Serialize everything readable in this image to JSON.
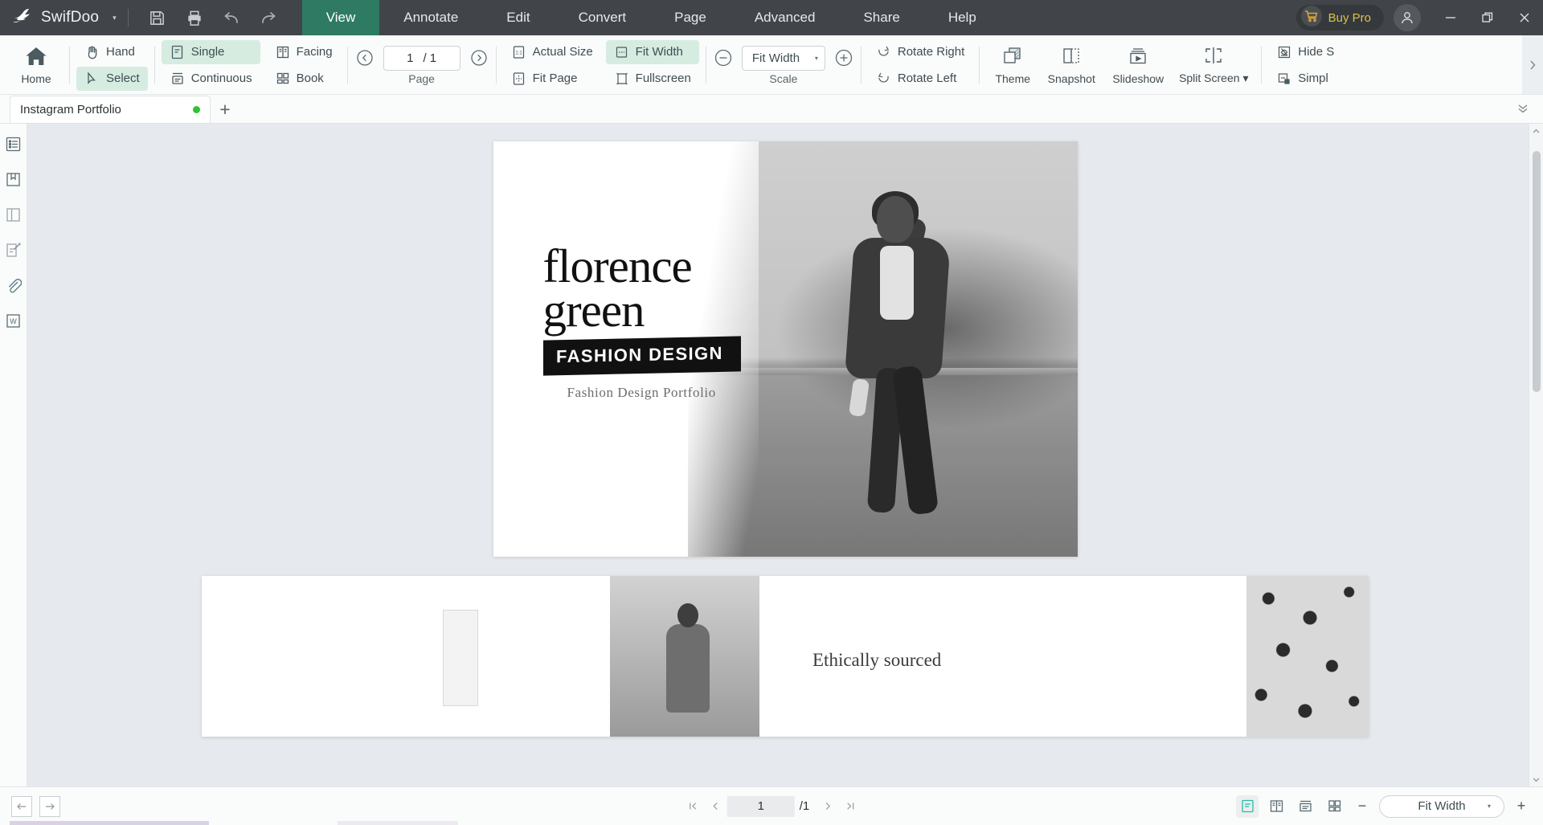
{
  "titlebar": {
    "brand": "SwifDoo",
    "brand_caret": "▾",
    "icons": {
      "save": "save-icon",
      "print": "print-icon",
      "undo": "undo-icon",
      "redo": "redo-icon"
    },
    "menus": [
      {
        "label": "View",
        "active": true
      },
      {
        "label": "Annotate",
        "active": false
      },
      {
        "label": "Edit",
        "active": false
      },
      {
        "label": "Convert",
        "active": false
      },
      {
        "label": "Page",
        "active": false
      },
      {
        "label": "Advanced",
        "active": false
      },
      {
        "label": "Share",
        "active": false
      },
      {
        "label": "Help",
        "active": false
      }
    ],
    "buy_pro": "Buy Pro",
    "account_icon": "user-account-icon",
    "window": {
      "minimize": "—",
      "restore": "❐",
      "close": "✕"
    },
    "colors": {
      "bar_bg": "#414549",
      "active_tab": "#2f7a62",
      "buy_pro_text": "#d9c24b"
    }
  },
  "ribbon": {
    "home": {
      "label": "Home",
      "icon": "home-icon"
    },
    "tools": [
      {
        "label": "Hand",
        "icon": "hand-icon",
        "active": false
      },
      {
        "label": "Select",
        "icon": "cursor-select-icon",
        "active": true
      }
    ],
    "layouts": [
      {
        "label": "Single",
        "icon": "single-page-icon",
        "active": true
      },
      {
        "label": "Continuous",
        "icon": "continuous-page-icon",
        "active": false
      },
      {
        "label": "Facing",
        "icon": "facing-page-icon",
        "active": false
      },
      {
        "label": "Book",
        "icon": "book-view-icon",
        "active": false
      }
    ],
    "page_nav": {
      "prev_icon": "chevron-left-circle-icon",
      "next_icon": "chevron-right-circle-icon",
      "current": "1",
      "separator": "/ 1",
      "caption": "Page"
    },
    "fit": [
      {
        "label": "Actual Size",
        "icon": "actual-size-icon",
        "active": false
      },
      {
        "label": "Fit Page",
        "icon": "fit-page-icon",
        "active": false
      },
      {
        "label": "Fit Width",
        "icon": "fit-width-icon",
        "active": true
      },
      {
        "label": "Fullscreen",
        "icon": "fullscreen-icon",
        "active": false
      }
    ],
    "scale": {
      "minus_icon": "zoom-out-circle-icon",
      "plus_icon": "zoom-in-circle-icon",
      "value": "Fit Width",
      "caret": "▾",
      "caption": "Scale"
    },
    "rotate": [
      {
        "label": "Rotate Right",
        "icon": "rotate-right-icon"
      },
      {
        "label": "Rotate Left",
        "icon": "rotate-left-icon"
      }
    ],
    "big_buttons": [
      {
        "label": "Theme",
        "icon": "theme-icon"
      },
      {
        "label": "Snapshot",
        "icon": "snapshot-icon"
      },
      {
        "label": "Slideshow",
        "icon": "slideshow-icon"
      },
      {
        "label": "Split Screen",
        "icon": "split-screen-icon",
        "caret": "▾"
      }
    ],
    "overflow": [
      {
        "label": "Hide S",
        "icon": "hide-scroll-icon"
      },
      {
        "label": "Simpl",
        "icon": "simplify-icon"
      }
    ],
    "expander_icon": "chevron-right-icon"
  },
  "tabstrip": {
    "tabs": [
      {
        "name": "Instagram Portfolio",
        "modified": true
      }
    ],
    "new_tab_icon": "plus-icon",
    "collapse_icon": "chevron-double-down-icon"
  },
  "rail": {
    "items": [
      {
        "name": "outline-panel",
        "icon": "list-outline-icon"
      },
      {
        "name": "bookmark-panel",
        "icon": "bookmark-icon"
      },
      {
        "name": "thumbnail-panel",
        "icon": "page-panel-icon"
      },
      {
        "name": "annotation-panel",
        "icon": "annotation-edit-icon"
      },
      {
        "name": "attachment-panel",
        "icon": "paperclip-icon"
      },
      {
        "name": "word-export-panel",
        "icon": "word-document-icon"
      }
    ]
  },
  "document": {
    "page1": {
      "title_line1": "florence",
      "title_line2": "green",
      "band": "FASHION DESIGN",
      "subtitle": "Fashion Design Portfolio"
    },
    "page2": {
      "text": "Ethically sourced"
    }
  },
  "statusbar": {
    "back_icon": "arrow-left-icon",
    "forward_icon": "arrow-right-icon",
    "first_icon": "first-page-icon",
    "prev_icon": "prev-page-icon",
    "current_page": "1",
    "total_pages": "/1",
    "next_icon": "next-page-icon",
    "last_icon": "last-page-icon",
    "view_modes": [
      {
        "name": "single-view-mode",
        "icon": "single-view-icon",
        "active": true
      },
      {
        "name": "facing-view-mode",
        "icon": "facing-view-icon",
        "active": false
      },
      {
        "name": "continuous-view-mode",
        "icon": "continuous-view-icon",
        "active": false
      },
      {
        "name": "grid-view-mode",
        "icon": "grid-view-icon",
        "active": false
      }
    ],
    "zoom_out": "−",
    "zoom_value": "Fit Width",
    "zoom_caret": "▾",
    "zoom_in": "+"
  }
}
